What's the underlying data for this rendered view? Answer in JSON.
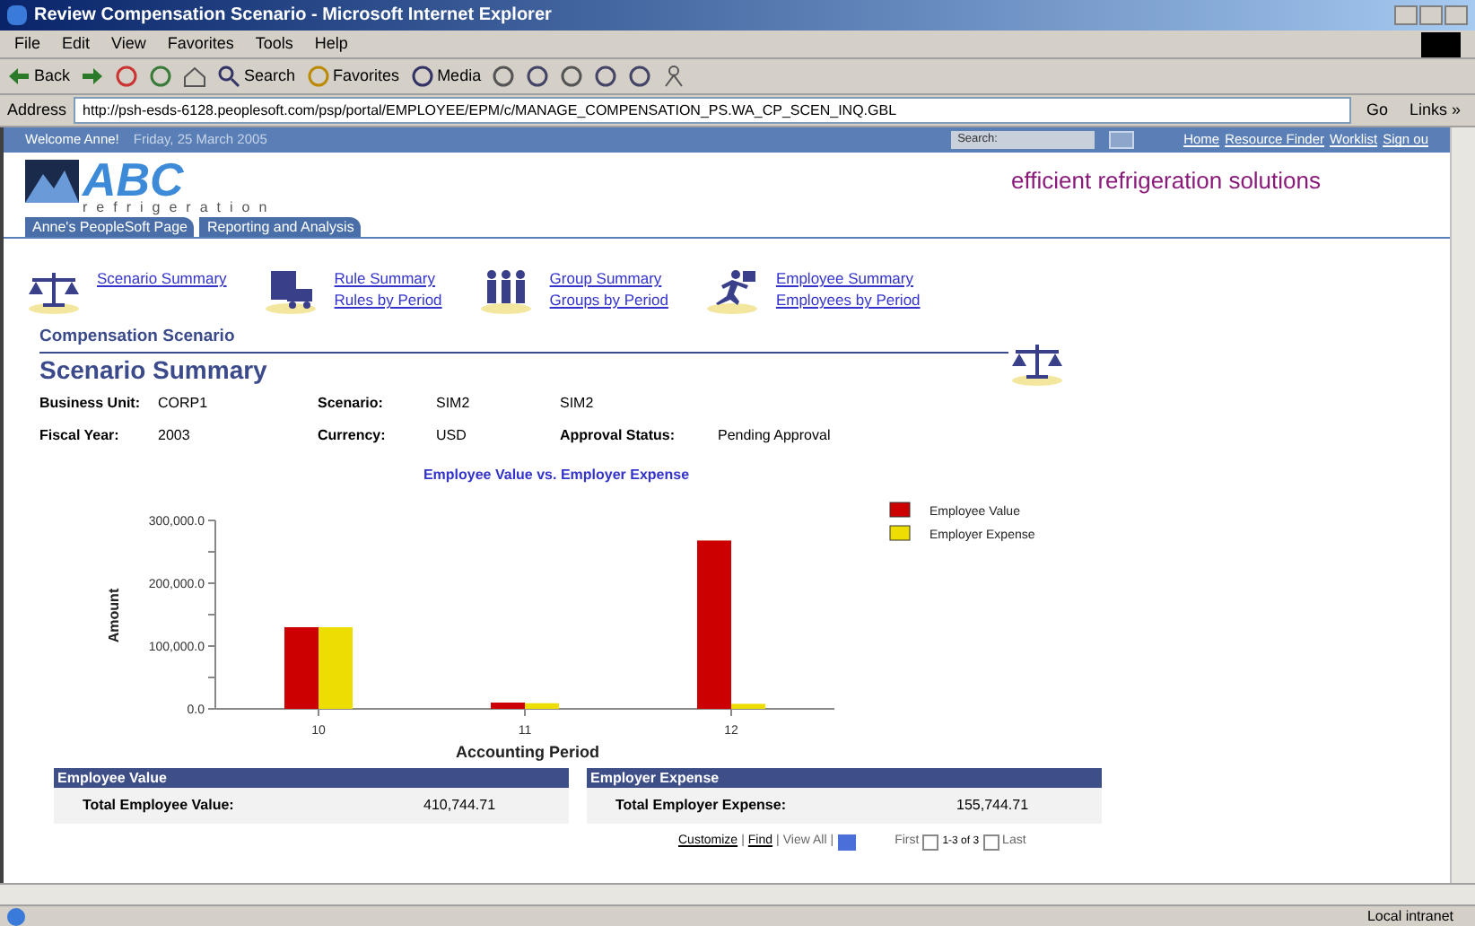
{
  "window": {
    "title": "Review Compensation Scenario - Microsoft Internet Explorer"
  },
  "menu": [
    "File",
    "Edit",
    "View",
    "Favorites",
    "Tools",
    "Help"
  ],
  "toolbar": [
    {
      "kind": "back",
      "label": "Back"
    },
    {
      "kind": "forward"
    },
    {
      "kind": "stop"
    },
    {
      "kind": "refresh"
    },
    {
      "kind": "home"
    },
    {
      "kind": "search",
      "label": "Search"
    },
    {
      "kind": "favorites",
      "label": "Favorites"
    },
    {
      "kind": "media",
      "label": "Media"
    },
    {
      "kind": "history"
    },
    {
      "kind": "mail"
    },
    {
      "kind": "print"
    },
    {
      "kind": "edit"
    },
    {
      "kind": "discuss"
    },
    {
      "kind": "messenger"
    }
  ],
  "address": {
    "label": "Address",
    "url": "http://psh-esds-6128.peoplesoft.com/psp/portal/EMPLOYEE/EPM/c/MANAGE_COMPENSATION_PS.WA_CP_SCEN_INQ.GBL",
    "go": "Go",
    "links": "Links »"
  },
  "header": {
    "welcome": "Welcome Anne!",
    "date": "Friday, 25 March 2005",
    "search_label": "Search:",
    "links": [
      "Home",
      "Resource Finder",
      "Worklist",
      "Sign ou"
    ]
  },
  "logo": {
    "name": "ABC",
    "sub": "refrigeration",
    "tagline": "efficient refrigeration solutions"
  },
  "tabs": [
    "Anne's PeopleSoft Page",
    "Reporting and Analysis"
  ],
  "nav": [
    {
      "kind": "scales",
      "links": [
        "Scenario Summary"
      ]
    },
    {
      "kind": "rules",
      "links": [
        "Rule Summary",
        "Rules by Period"
      ]
    },
    {
      "kind": "group",
      "links": [
        "Group Summary",
        "Groups by Period"
      ]
    },
    {
      "kind": "runner",
      "links": [
        "Employee Summary",
        "Employees by Period"
      ]
    }
  ],
  "section": {
    "caption": "Compensation Scenario",
    "title": "Scenario Summary"
  },
  "fields": [
    [
      {
        "label": "Business Unit:",
        "value": "CORP1"
      },
      {
        "label": "Scenario:",
        "value": "SIM2"
      },
      {
        "value": "SIM2"
      }
    ],
    [
      {
        "label": "Fiscal Year:",
        "value": "2003"
      },
      {
        "label": "Currency:",
        "value": "USD"
      },
      {
        "label": "Approval Status:",
        "value": "Pending Approval"
      }
    ]
  ],
  "chart_data": {
    "type": "bar",
    "title": "Employee Value vs. Employer Expense",
    "xlabel": "Accounting Period",
    "ylabel": "Amount",
    "categories": [
      "10",
      "11",
      "12"
    ],
    "series": [
      {
        "name": "Employee Value",
        "color": "#cc0000",
        "values": [
          130000,
          10000,
          268000
        ]
      },
      {
        "name": "Employer Expense",
        "color": "#eedd00",
        "values": [
          130000,
          9000,
          8000
        ]
      }
    ],
    "legend": true,
    "ylim": [
      0,
      300000
    ],
    "yticks": [
      {
        "value": 0,
        "label": "0.0"
      },
      {
        "value": 100000,
        "label": "100,000.0"
      },
      {
        "value": 200000,
        "label": "200,000.0"
      },
      {
        "value": 300000,
        "label": "300,000.0"
      }
    ]
  },
  "totals": [
    {
      "heading": "Employee Value",
      "label": "Total Employee Value:",
      "value": "410,744.71"
    },
    {
      "heading": "Employer Expense",
      "label": "Total Employer Expense:",
      "value": "155,744.71"
    }
  ],
  "grid_nav": {
    "separators": [
      "|",
      "|",
      "|"
    ],
    "customize": "Customize",
    "find": "Find",
    "view_all": "View All",
    "first": "First",
    "range": "1-3 of 3",
    "last": "Last"
  },
  "status": {
    "zone": "Local intranet"
  }
}
